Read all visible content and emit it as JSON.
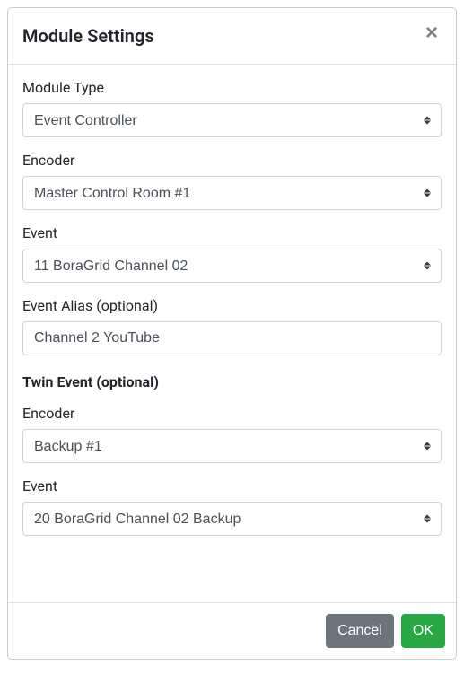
{
  "header": {
    "title": "Module Settings",
    "close_label": "×"
  },
  "form": {
    "module_type": {
      "label": "Module Type",
      "value": "Event Controller"
    },
    "encoder": {
      "label": "Encoder",
      "value": "Master Control Room #1"
    },
    "event": {
      "label": "Event",
      "value": "11 BoraGrid Channel 02"
    },
    "event_alias": {
      "label": "Event Alias (optional)",
      "value": "Channel 2 YouTube"
    },
    "twin_section": {
      "title": "Twin Event (optional)",
      "encoder": {
        "label": "Encoder",
        "value": "Backup #1"
      },
      "event": {
        "label": "Event",
        "value": "20 BoraGrid Channel 02 Backup"
      }
    }
  },
  "footer": {
    "cancel_label": "Cancel",
    "ok_label": "OK"
  }
}
